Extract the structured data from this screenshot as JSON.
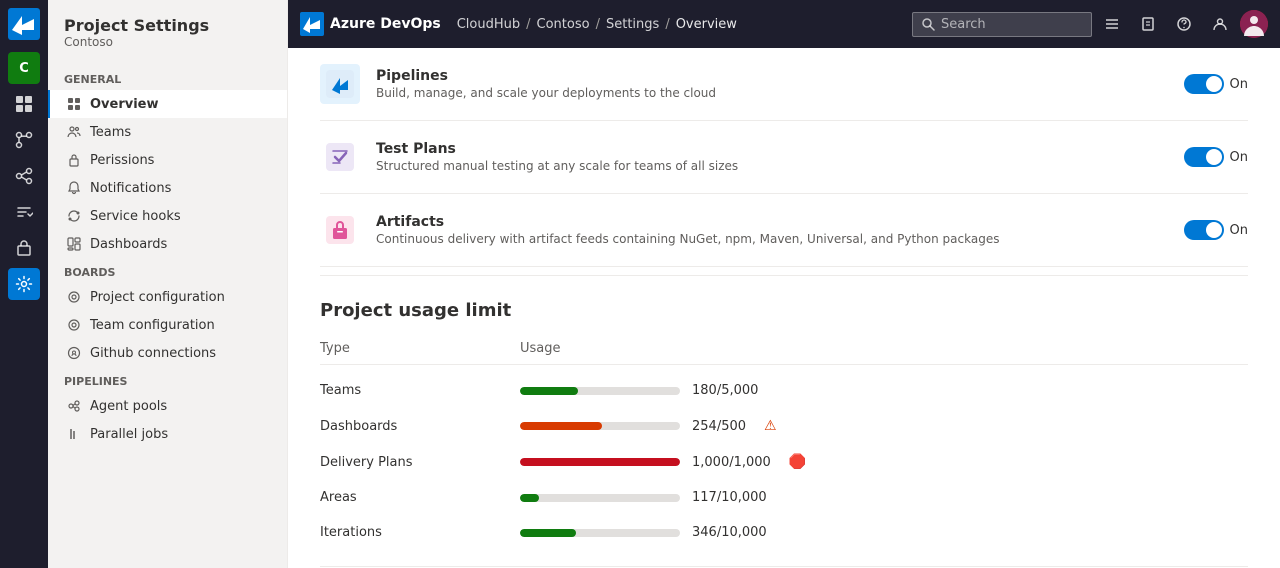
{
  "brand": {
    "logo_text": "Azure DevOps",
    "org": "CloudHub",
    "project": "Contoso",
    "section": "Settings",
    "page": "Overview"
  },
  "topbar": {
    "search_placeholder": "Search",
    "icons": [
      "list-icon",
      "badge-icon",
      "help-icon",
      "user-icon"
    ],
    "avatar_initials": ""
  },
  "sidebar": {
    "title": "Project Settings",
    "subtitle": "Contoso",
    "general_label": "General",
    "overview_label": "Overview",
    "teams_label": "Teams",
    "permissions_label": "Perissions",
    "notifications_label": "Notifications",
    "service_hooks_label": "Service hooks",
    "dashboards_label": "Dashboards",
    "boards_label": "Boards",
    "project_configuration_label": "Project configuration",
    "team_configuration_label": "Team configuration",
    "github_connections_label": "Github connections",
    "pipelines_label": "Pipelines",
    "agent_pools_label": "Agent pools",
    "parallel_jobs_label": "Parallel jobs"
  },
  "icon_bar": {
    "items": [
      {
        "name": "home-icon",
        "symbol": "⌂",
        "active": false
      },
      {
        "name": "board-icon",
        "symbol": "▦",
        "active": false
      },
      {
        "name": "repo-icon",
        "symbol": "⎇",
        "active": false
      },
      {
        "name": "pipelines-icon",
        "symbol": "↻",
        "active": false
      },
      {
        "name": "testplans-icon",
        "symbol": "✓",
        "active": false
      },
      {
        "name": "artifacts-icon",
        "symbol": "◈",
        "active": false
      },
      {
        "name": "settings-icon",
        "symbol": "⚙",
        "active": true
      }
    ]
  },
  "services": [
    {
      "name": "Pipelines",
      "description": "Build, manage, and scale your deployments to the cloud",
      "status": "On",
      "enabled": true,
      "color": "#0078d4"
    },
    {
      "name": "Test Plans",
      "description": "Structured manual testing at any scale for teams of all sizes",
      "status": "On",
      "enabled": true,
      "color": "#8764b8"
    },
    {
      "name": "Artifacts",
      "description": "Continuous delivery with artifact feeds containing NuGet, npm, Maven, Universal, and Python packages",
      "status": "On",
      "enabled": true,
      "color": "#e05599"
    }
  ],
  "usage": {
    "section_title": "Project usage limit",
    "col_type": "Type",
    "col_usage": "Usage",
    "rows": [
      {
        "type": "Teams",
        "used": 180,
        "total": 5000,
        "display": "180/5,000",
        "color": "green",
        "bar_pct": 36,
        "warn": false,
        "error": false
      },
      {
        "type": "Dashboards",
        "used": 254,
        "total": 500,
        "display": "254/500",
        "color": "orange",
        "bar_pct": 51,
        "warn": true,
        "error": false
      },
      {
        "type": "Delivery Plans",
        "used": 1000,
        "total": 1000,
        "display": "1,000/1,000",
        "color": "red",
        "bar_pct": 100,
        "warn": false,
        "error": true
      },
      {
        "type": "Areas",
        "used": 117,
        "total": 10000,
        "display": "117/10,000",
        "color": "green",
        "bar_pct": 12,
        "warn": false,
        "error": false
      },
      {
        "type": "Iterations",
        "used": 346,
        "total": 10000,
        "display": "346/10,000",
        "color": "green",
        "bar_pct": 35,
        "warn": false,
        "error": false
      }
    ]
  }
}
